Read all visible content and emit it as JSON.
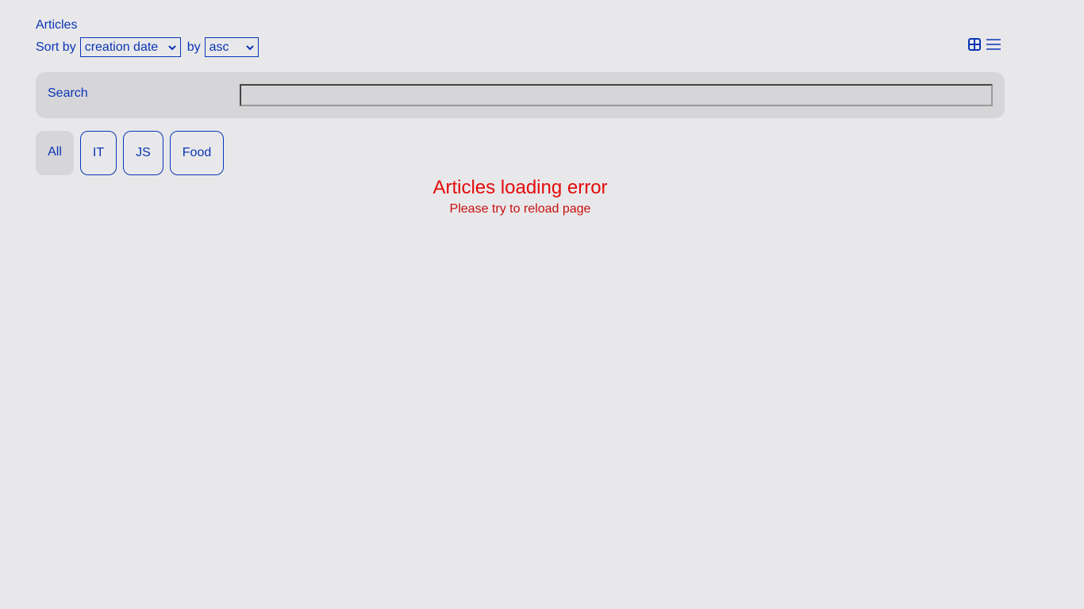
{
  "header": {
    "title": "Articles"
  },
  "sort": {
    "sort_by_label": "Sort by",
    "field_value": "creation date",
    "by_label": "by",
    "order_value": "asc"
  },
  "view_switch": {
    "tile_icon": "grid-icon",
    "list_icon": "list-icon"
  },
  "search": {
    "label": "Search",
    "value": "",
    "placeholder": ""
  },
  "tabs": [
    {
      "label": "All",
      "active": true
    },
    {
      "label": "IT",
      "active": false
    },
    {
      "label": "JS",
      "active": false
    },
    {
      "label": "Food",
      "active": false
    }
  ],
  "error": {
    "title": "Articles loading error",
    "subtitle": "Please try to reload page"
  },
  "colors": {
    "accent": "#0b34b5",
    "background": "#e8e8ea",
    "panel": "#d6d6d9",
    "error": "#e30b0b"
  }
}
